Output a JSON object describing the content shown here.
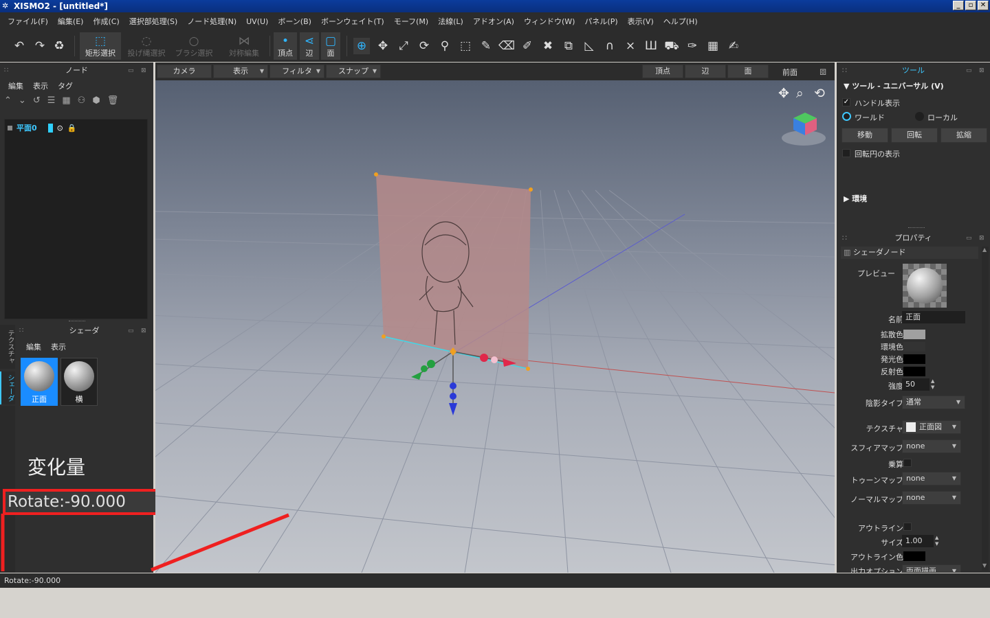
{
  "window": {
    "title": "XISMO2 - [untitled*]",
    "minimize": "_",
    "restore": "▫",
    "close": "✕"
  },
  "menu": [
    "ファイル(F)",
    "編集(E)",
    "作成(C)",
    "選択部処理(S)",
    "ノード処理(N)",
    "UV(U)",
    "ボーン(B)",
    "ボーンウェイト(T)",
    "モーフ(M)",
    "法線(L)",
    "アドオン(A)",
    "ウィンドウ(W)",
    "パネル(P)",
    "表示(V)",
    "ヘルプ(H)"
  ],
  "toolbar": {
    "rect_select": "矩形選択",
    "lasso_select": "投げ縄選択",
    "brush_select": "ブラシ選択",
    "symmetry_edit": "対称編集",
    "vertex": "頂点",
    "edge": "辺",
    "face": "面"
  },
  "node_panel": {
    "title": "ノード",
    "menu": [
      "編集",
      "表示",
      "タグ"
    ],
    "tree_item": "平面0"
  },
  "shader_panel": {
    "title": "シェーダ",
    "menu": [
      "編集",
      "表示"
    ],
    "side_tabs": [
      "テクスチャ",
      "シェーダ"
    ],
    "items": [
      "正面",
      "横"
    ]
  },
  "delta": {
    "title": "変化量",
    "value": "Rotate:-90.000"
  },
  "viewport_bar": {
    "camera": "カメラ",
    "display": "表示",
    "filter": "フィルタ",
    "snap": "スナップ",
    "vertex": "頂点",
    "edge": "辺",
    "face": "面",
    "view_name": "前面"
  },
  "tools_panel": {
    "title": "ツール",
    "section": "ツール - ユニバーサル (V)",
    "handle_display": "ハンドル表示",
    "world": "ワールド",
    "local": "ローカル",
    "move": "移動",
    "rotate": "回転",
    "scale": "拡縮",
    "rotation_circle": "回転円の表示",
    "environment": "環境"
  },
  "properties_panel": {
    "title": "プロパティ",
    "section": "シェーダノード",
    "preview": "プレビュー",
    "name_label": "名前",
    "name_value": "正面",
    "diffuse": "拡散色",
    "ambient": "環境色",
    "emissive": "発光色",
    "specular": "反射色",
    "strength_label": "強度",
    "strength_value": "50",
    "shading_label": "陰影タイプ",
    "shading_value": "通常",
    "texture_label": "テクスチャ",
    "texture_value": "正面図",
    "sphere_label": "スフィアマップ",
    "sphere_value": "none",
    "multiply_label": "乗算",
    "toon_label": "トゥーンマップ",
    "toon_value": "none",
    "normal_label": "ノーマルマップ",
    "normal_value": "none",
    "outline_label": "アウトライン",
    "size_label": "サイズ",
    "size_value": "1.00",
    "outline_color_label": "アウトライン色",
    "output_label": "出力オプション",
    "output_value": "両面描画"
  },
  "colors": {
    "accent": "#3ec8ff",
    "highlight": "#ef2020",
    "diffuse": "#a0a0a0",
    "plane": "#b58989"
  },
  "status": "Rotate:-90.000"
}
